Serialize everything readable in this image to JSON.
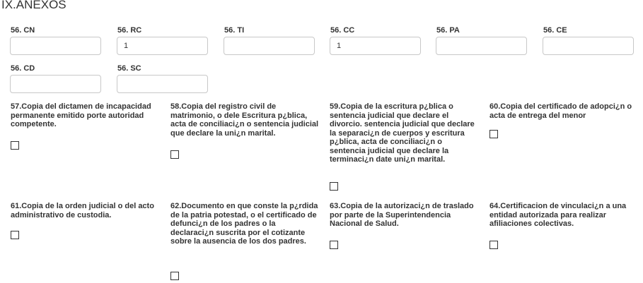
{
  "section": {
    "title": "IX.ANEXOS"
  },
  "fields": {
    "cn": {
      "label": "56. CN",
      "value": ""
    },
    "rc": {
      "label": "56. RC",
      "value": "1"
    },
    "ti": {
      "label": "56. TI",
      "value": ""
    },
    "cc": {
      "label": "56. CC",
      "value": "1"
    },
    "pa": {
      "label": "56. PA",
      "value": ""
    },
    "ce": {
      "label": "56. CE",
      "value": ""
    },
    "cd": {
      "label": "56. CD",
      "value": ""
    },
    "sc": {
      "label": "56. SC",
      "value": ""
    }
  },
  "documents": {
    "d57": {
      "label": "57.Copia del dictamen de incapacidad permanente emitido porte autoridad competente.",
      "checked": false
    },
    "d58": {
      "label": "58.Copia del registro civil de matrimonio, o dele Escritura p¿blica, acta de conciliaci¿n o sentencia judicial que declare la uni¿n marital.",
      "checked": false
    },
    "d59": {
      "label": "59.Copia de la escritura p¿blica o sentencia judicial que declare el divorcio. sentencia judicial que declare la separaci¿n de cuerpos y escritura p¿blica, acta de conciliaci¿n o sentencia judicial que declare la terminaci¿n date uni¿n marital.",
      "checked": false
    },
    "d60": {
      "label": "60.Copia del certificado de adopci¿n o acta de entrega del menor",
      "checked": false
    },
    "d61": {
      "label": "61.Copia de la orden judicial o del acto administrativo de custodia.",
      "checked": false
    },
    "d62": {
      "label": "62.Documento en que conste la p¿rdida de la patria potestad, o el certificado de defunci¿n de los padres o la declaraci¿n suscrita por el cotizante sobre la ausencia de los dos padres.",
      "checked": false
    },
    "d63": {
      "label": "63.Copia de la autorizaci¿n de traslado por parte de la Superintendencia Nacional de Salud.",
      "checked": false
    },
    "d64": {
      "label": "64.Certificacion de vinculaci¿n a una entidad autorizada para realizar afiliaciones colectivas.",
      "checked": false
    }
  }
}
